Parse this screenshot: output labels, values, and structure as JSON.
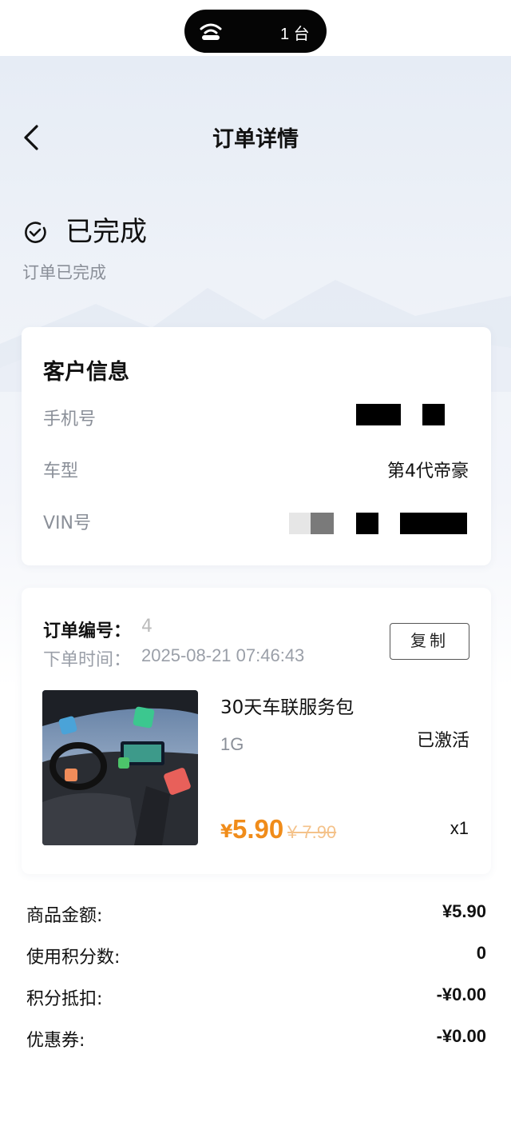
{
  "status_bar": {
    "device_count": "1 台"
  },
  "header": {
    "title": "订单详情"
  },
  "order_status": {
    "title": "已完成",
    "subtitle": "订单已完成"
  },
  "customer": {
    "title": "客户信息",
    "phone_label": "手机号",
    "model_label": "车型",
    "model_value": "第4代帝豪",
    "vin_label": "VIN号"
  },
  "order": {
    "number_label": "订单编号：",
    "number_value": "4",
    "time_label": "下单时间：",
    "time_value": "2025-08-21 07:46:43",
    "copy_label": "复制"
  },
  "product": {
    "name": "30天车联服务包",
    "spec": "1G",
    "status": "已激活",
    "currency": "¥",
    "price": "5.90",
    "original_price": "¥ 7.90",
    "quantity": "x1"
  },
  "summary": [
    {
      "label": "商品金额:",
      "value": "¥5.90"
    },
    {
      "label": "使用积分数:",
      "value": "0"
    },
    {
      "label": "积分抵扣:",
      "value": "-¥0.00"
    },
    {
      "label": "优惠券:",
      "value": "-¥0.00"
    }
  ],
  "colors": {
    "accent_price": "#f08c1a",
    "original_price": "#f4c28a",
    "muted_text": "#8a8f98"
  },
  "icons": [
    "wifi-icon",
    "back-arrow-icon",
    "check-circle-icon"
  ]
}
